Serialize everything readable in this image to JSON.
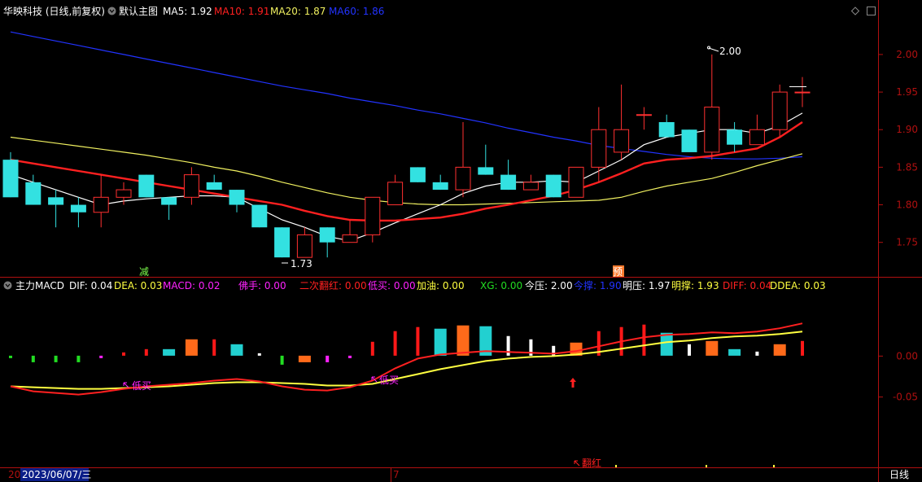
{
  "colors": {
    "up": "#ff3030",
    "down": "#33e1e1",
    "ma5": "#ffffff",
    "ma10": "#ff2020",
    "ma20": "#f0f060",
    "ma60": "#2233ff",
    "axis": "#b01010",
    "text": "#ffffff",
    "hist_red": "#ff1818",
    "hist_cyan": "#22d0d0",
    "hist_orange": "#ff6a1a",
    "hist_white": "#ffffff",
    "hist_green": "#22dd22",
    "hist_magenta": "#ff22ff"
  },
  "header": {
    "stock_name": "华映科技 (日线,前复权)",
    "main_label": "默认主图",
    "ma5": "MA5: 1.92",
    "ma10": "MA10: 1.91",
    "ma20": "MA20: 1.87",
    "ma60": "MA60: 1.86"
  },
  "indicator_header": {
    "name": "主力MACD",
    "dif": "DIF: 0.04",
    "dea": "DEA: 0.03",
    "macd": "MACD: 0.02",
    "foshou": "佛手: 0.00",
    "erci": "二次翻红: 0.00",
    "dimai": "低买: 0.00",
    "jiayou": "加油: 0.00",
    "xg": "XG: 0.00",
    "jinya": "今压: 2.00",
    "jinzhi": "今撑: 1.90",
    "mingya": "明压: 1.97",
    "mingzhi": "明撑: 1.93",
    "diff": "DIFF: 0.04",
    "ddea": "DDEA: 0.03"
  },
  "footer": {
    "date_cursor": "2023/06/07/三",
    "left_month_stub": "20",
    "month_mark": "7",
    "period": "日线"
  },
  "markers": {
    "reduce": "减",
    "preview": "预",
    "max_label": "2.00",
    "min_label": "1.73",
    "low_buy": "低买",
    "turn_red": "翻红"
  },
  "chart_data": [
    {
      "type": "candlestick",
      "title": "华映科技 (日线,前复权)",
      "y_ticks": [
        "2.00",
        "1.95",
        "1.90",
        "1.85",
        "1.80",
        "1.75"
      ],
      "ylim": [
        1.715,
        2.04
      ],
      "candles": [
        {
          "o": 1.86,
          "h": 1.87,
          "l": 1.81,
          "c": 1.81
        },
        {
          "o": 1.83,
          "h": 1.84,
          "l": 1.8,
          "c": 1.8
        },
        {
          "o": 1.81,
          "h": 1.82,
          "l": 1.77,
          "c": 1.8
        },
        {
          "o": 1.8,
          "h": 1.81,
          "l": 1.77,
          "c": 1.79
        },
        {
          "o": 1.79,
          "h": 1.84,
          "l": 1.77,
          "c": 1.81
        },
        {
          "o": 1.81,
          "h": 1.83,
          "l": 1.8,
          "c": 1.82
        },
        {
          "o": 1.84,
          "h": 1.84,
          "l": 1.81,
          "c": 1.81
        },
        {
          "o": 1.81,
          "h": 1.81,
          "l": 1.78,
          "c": 1.8
        },
        {
          "o": 1.81,
          "h": 1.85,
          "l": 1.8,
          "c": 1.84
        },
        {
          "o": 1.83,
          "h": 1.84,
          "l": 1.82,
          "c": 1.82
        },
        {
          "o": 1.82,
          "h": 1.82,
          "l": 1.79,
          "c": 1.8
        },
        {
          "o": 1.8,
          "h": 1.8,
          "l": 1.77,
          "c": 1.77
        },
        {
          "o": 1.77,
          "h": 1.77,
          "l": 1.73,
          "c": 1.73
        },
        {
          "o": 1.73,
          "h": 1.77,
          "l": 1.73,
          "c": 1.76
        },
        {
          "o": 1.77,
          "h": 1.77,
          "l": 1.73,
          "c": 1.75
        },
        {
          "o": 1.75,
          "h": 1.78,
          "l": 1.75,
          "c": 1.76
        },
        {
          "o": 1.76,
          "h": 1.81,
          "l": 1.75,
          "c": 1.81
        },
        {
          "o": 1.8,
          "h": 1.84,
          "l": 1.8,
          "c": 1.83
        },
        {
          "o": 1.85,
          "h": 1.85,
          "l": 1.83,
          "c": 1.83
        },
        {
          "o": 1.83,
          "h": 1.84,
          "l": 1.82,
          "c": 1.82
        },
        {
          "o": 1.82,
          "h": 1.91,
          "l": 1.81,
          "c": 1.85
        },
        {
          "o": 1.85,
          "h": 1.88,
          "l": 1.84,
          "c": 1.84
        },
        {
          "o": 1.84,
          "h": 1.86,
          "l": 1.82,
          "c": 1.82
        },
        {
          "o": 1.82,
          "h": 1.84,
          "l": 1.82,
          "c": 1.83
        },
        {
          "o": 1.84,
          "h": 1.84,
          "l": 1.81,
          "c": 1.81
        },
        {
          "o": 1.81,
          "h": 1.85,
          "l": 1.81,
          "c": 1.85
        },
        {
          "o": 1.85,
          "h": 1.93,
          "l": 1.83,
          "c": 1.9
        },
        {
          "o": 1.87,
          "h": 1.96,
          "l": 1.86,
          "c": 1.9
        },
        {
          "o": 1.92,
          "h": 1.93,
          "l": 1.9,
          "c": 1.92
        },
        {
          "o": 1.91,
          "h": 1.92,
          "l": 1.89,
          "c": 1.89
        },
        {
          "o": 1.9,
          "h": 1.9,
          "l": 1.87,
          "c": 1.87
        },
        {
          "o": 1.87,
          "h": 2.0,
          "l": 1.86,
          "c": 1.93
        },
        {
          "o": 1.9,
          "h": 1.91,
          "l": 1.87,
          "c": 1.88
        },
        {
          "o": 1.88,
          "h": 1.92,
          "l": 1.88,
          "c": 1.9
        },
        {
          "o": 1.9,
          "h": 1.96,
          "l": 1.89,
          "c": 1.95
        },
        {
          "o": 1.95,
          "h": 1.97,
          "l": 1.93,
          "c": 1.95
        }
      ],
      "ma5": [
        1.84,
        1.83,
        1.82,
        1.81,
        1.8,
        1.805,
        1.808,
        1.81,
        1.812,
        1.812,
        1.81,
        1.795,
        1.78,
        1.77,
        1.758,
        1.752,
        1.763,
        1.776,
        1.788,
        1.8,
        1.815,
        1.825,
        1.83,
        1.83,
        1.832,
        1.83,
        1.845,
        1.86,
        1.88,
        1.89,
        1.895,
        1.9,
        1.9,
        1.895,
        1.905,
        1.922
      ],
      "ma10": [
        1.86,
        1.855,
        1.85,
        1.845,
        1.84,
        1.835,
        1.83,
        1.825,
        1.82,
        1.815,
        1.81,
        1.805,
        1.8,
        1.792,
        1.785,
        1.78,
        1.779,
        1.779,
        1.781,
        1.783,
        1.788,
        1.795,
        1.8,
        1.806,
        1.812,
        1.82,
        1.83,
        1.842,
        1.855,
        1.86,
        1.862,
        1.865,
        1.87,
        1.875,
        1.89,
        1.91
      ],
      "ma20": [
        1.89,
        1.886,
        1.882,
        1.878,
        1.874,
        1.87,
        1.866,
        1.861,
        1.856,
        1.85,
        1.845,
        1.838,
        1.83,
        1.823,
        1.816,
        1.81,
        1.806,
        1.803,
        1.801,
        1.8,
        1.8,
        1.801,
        1.802,
        1.803,
        1.804,
        1.805,
        1.806,
        1.81,
        1.818,
        1.825,
        1.83,
        1.835,
        1.843,
        1.852,
        1.86,
        1.868
      ],
      "ma60": [
        2.03,
        2.024,
        2.018,
        2.012,
        2.006,
        2.0,
        1.994,
        1.988,
        1.982,
        1.976,
        1.97,
        1.964,
        1.958,
        1.953,
        1.948,
        1.942,
        1.937,
        1.932,
        1.926,
        1.921,
        1.915,
        1.909,
        1.902,
        1.896,
        1.89,
        1.885,
        1.879,
        1.875,
        1.871,
        1.867,
        1.864,
        1.862,
        1.861,
        1.861,
        1.862,
        1.864
      ]
    },
    {
      "type": "bar",
      "title": "主力MACD",
      "y_ticks": [
        "0.00",
        "-0.05"
      ],
      "ylim": [
        -0.13,
        0.075
      ],
      "histogram": [
        {
          "v": 0.003,
          "c": "hist_green"
        },
        {
          "v": 0.008,
          "c": "hist_green"
        },
        {
          "v": 0.008,
          "c": "hist_green"
        },
        {
          "v": 0.008,
          "c": "hist_green"
        },
        {
          "v": 0.003,
          "c": "hist_magenta"
        },
        {
          "v": 0.004,
          "c": "hist_red"
        },
        {
          "v": 0.008,
          "c": "hist_red"
        },
        {
          "v": 0.008,
          "c": "hist_cyan"
        },
        {
          "v": 0.02,
          "c": "hist_orange"
        },
        {
          "v": 0.02,
          "c": "hist_red"
        },
        {
          "v": 0.014,
          "c": "hist_cyan"
        },
        {
          "v": 0.002,
          "c": "hist_white"
        },
        {
          "v": -0.011,
          "c": "hist_green"
        },
        {
          "v": -0.008,
          "c": "hist_orange"
        },
        {
          "v": -0.008,
          "c": "hist_magenta"
        },
        {
          "v": -0.003,
          "c": "hist_magenta"
        },
        {
          "v": 0.017,
          "c": "hist_red"
        },
        {
          "v": 0.03,
          "c": "hist_red"
        },
        {
          "v": 0.035,
          "c": "hist_red"
        },
        {
          "v": 0.033,
          "c": "hist_cyan"
        },
        {
          "v": 0.037,
          "c": "hist_orange"
        },
        {
          "v": 0.036,
          "c": "hist_cyan"
        },
        {
          "v": 0.024,
          "c": "hist_white"
        },
        {
          "v": 0.02,
          "c": "hist_white"
        },
        {
          "v": 0.012,
          "c": "hist_white"
        },
        {
          "v": 0.016,
          "c": "hist_orange"
        },
        {
          "v": 0.03,
          "c": "hist_red"
        },
        {
          "v": 0.035,
          "c": "hist_red"
        },
        {
          "v": 0.038,
          "c": "hist_red"
        },
        {
          "v": 0.028,
          "c": "hist_cyan"
        },
        {
          "v": 0.014,
          "c": "hist_white"
        },
        {
          "v": 0.018,
          "c": "hist_orange"
        },
        {
          "v": 0.008,
          "c": "hist_cyan"
        },
        {
          "v": 0.005,
          "c": "hist_white"
        },
        {
          "v": 0.014,
          "c": "hist_orange"
        },
        {
          "v": 0.018,
          "c": "hist_red"
        }
      ],
      "dif": [
        -0.037,
        -0.043,
        -0.045,
        -0.047,
        -0.044,
        -0.04,
        -0.037,
        -0.035,
        -0.033,
        -0.03,
        -0.028,
        -0.031,
        -0.037,
        -0.041,
        -0.042,
        -0.038,
        -0.03,
        -0.015,
        -0.003,
        0.002,
        0.004,
        0.006,
        0.005,
        0.004,
        0.003,
        0.006,
        0.012,
        0.018,
        0.023,
        0.026,
        0.027,
        0.029,
        0.028,
        0.03,
        0.034,
        0.04
      ],
      "dea": [
        -0.037,
        -0.038,
        -0.039,
        -0.04,
        -0.04,
        -0.039,
        -0.038,
        -0.037,
        -0.035,
        -0.033,
        -0.032,
        -0.032,
        -0.033,
        -0.034,
        -0.036,
        -0.036,
        -0.034,
        -0.028,
        -0.022,
        -0.016,
        -0.011,
        -0.006,
        -0.003,
        -0.001,
        0.0,
        0.002,
        0.005,
        0.009,
        0.013,
        0.017,
        0.019,
        0.022,
        0.024,
        0.025,
        0.027,
        0.03
      ]
    }
  ]
}
